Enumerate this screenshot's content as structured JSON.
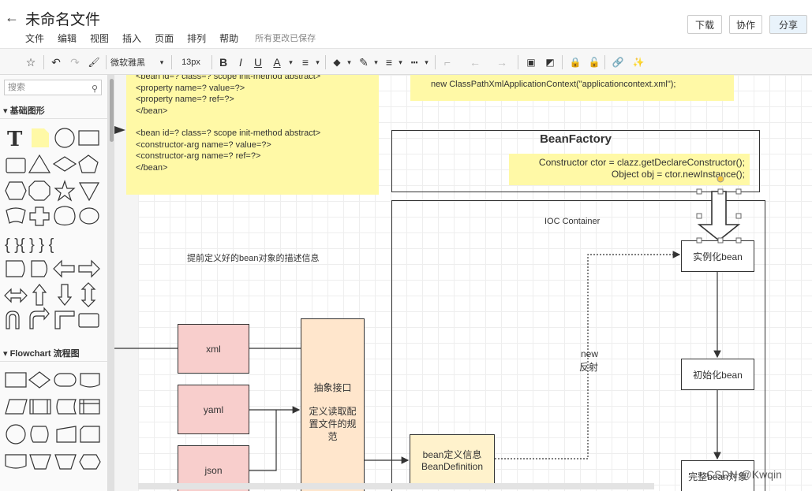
{
  "header": {
    "back_icon": "←",
    "title": "未命名文件",
    "menu": [
      "文件",
      "编辑",
      "视图",
      "插入",
      "页面",
      "排列",
      "帮助"
    ],
    "save_status": "所有更改已保存",
    "download_label": "下载",
    "collab_label": "协作",
    "share_label": "分享"
  },
  "toolbar": {
    "font_family": "微软雅黑",
    "font_size": "13px",
    "bold": "B",
    "italic": "I",
    "underline": "U",
    "font_color": "A",
    "align": "≡",
    "fill": "◆",
    "line_color": "✎",
    "line_weight": "≡",
    "line_style": "┅",
    "waypoint": "⌐",
    "arrow_start": "←",
    "arrow_end": "→",
    "lock": "🔒",
    "link": "🔗",
    "magic": "✨",
    "format_painter": "🖌",
    "undo": "↶",
    "redo": "↷",
    "brush": "☆"
  },
  "sidebar": {
    "search_placeholder": "搜索",
    "basic_shapes_title": "基础图形",
    "flowchart_title": "Flowchart 流程图",
    "text_glyph": "T",
    "brace_glyphs": "{ }{ } }  {"
  },
  "diagram": {
    "note_bean_xml": [
      "<bean id=? class=? scope init-method  abstract>",
      "<property name=? value=?>",
      "<property name=? ref=?>",
      "</bean>",
      "",
      "<bean id=? class=? scope init-method  abstract>",
      "<constructor-arg name=? value=?>",
      "<constructor-arg  name=? ref=?>",
      "</bean>"
    ],
    "note_context": "new ClassPathXmlApplicationContext(\"applicationcontext.xml\");",
    "beanfactory_title": "BeanFactory",
    "note_ctor_line1": "Constructor ctor = clazz.getDeclareConstructor();",
    "note_ctor_line2": "Object obj = ctor.newInstance();",
    "ioc_label": "IOC  Container",
    "predefined_label": "提前定义好的bean对象的描述信息",
    "xml_label": "xml",
    "yaml_label": "yaml",
    "json_label": "json",
    "abstract_line1": "抽象接口",
    "abstract_line2": "定义读取配置文件的规范",
    "beandef_line1": "bean定义信息",
    "beandef_line2": "BeanDefinition",
    "new_label": "new",
    "reflect_label": "反射",
    "instantiate_label": "实例化bean",
    "init_label": "初始化bean",
    "complete_label": "完整bean对象"
  },
  "watermark": "CSDN @Kwqin",
  "colors": {
    "note_yellow": "#fff9a6",
    "pink": "#f8cecc",
    "peach": "#ffe6cc",
    "light_yellow": "#fff2cc"
  }
}
